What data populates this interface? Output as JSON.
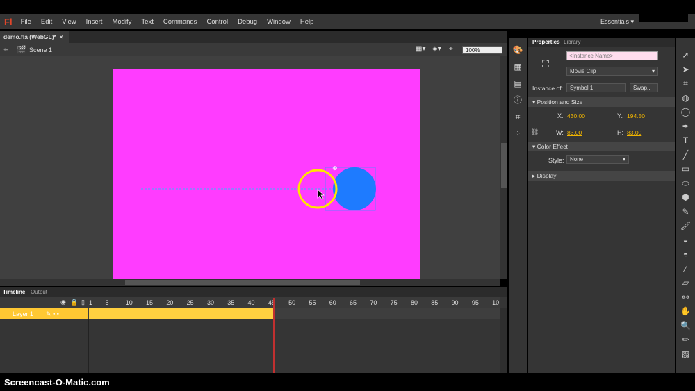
{
  "app": {
    "logo": "Fl",
    "workspace": "Essentials"
  },
  "menu": [
    "File",
    "Edit",
    "View",
    "Insert",
    "Modify",
    "Text",
    "Commands",
    "Control",
    "Debug",
    "Window",
    "Help"
  ],
  "document_tab": {
    "label": "demo.fla (WebGL)*",
    "close": "×"
  },
  "scene": {
    "label": "Scene 1",
    "zoom": "100%"
  },
  "panel_tabs": {
    "properties": "Properties",
    "library": "Library"
  },
  "properties": {
    "instance_name_placeholder": "<Instance Name>",
    "symbol_type": "Movie Clip",
    "instance_of_label": "Instance of:",
    "instance_of": "Symbol 1",
    "swap": "Swap...",
    "position_size": "Position and Size",
    "x_label": "X:",
    "x": "430.00",
    "y_label": "Y:",
    "y": "194.50",
    "w_label": "W:",
    "w": "83.00",
    "h_label": "H:",
    "h": "83.00",
    "color_effect": "Color Effect",
    "style_label": "Style:",
    "style": "None",
    "display": "Display"
  },
  "timeline": {
    "tabs": [
      "Timeline",
      "Output"
    ],
    "frame_labels": [
      "1",
      "5",
      "10",
      "15",
      "20",
      "25",
      "30",
      "35",
      "40",
      "45",
      "50",
      "55",
      "60",
      "65",
      "70",
      "75",
      "80",
      "85",
      "90",
      "95",
      "10"
    ],
    "layer": "Layer 1",
    "current_frame": 45
  },
  "colors": {
    "stage": "#ff3cff",
    "circle": "#1e7bff",
    "highlight": "#ffe600",
    "layer": "#ffc833"
  },
  "footer": "Screencast-O-Matic.com"
}
